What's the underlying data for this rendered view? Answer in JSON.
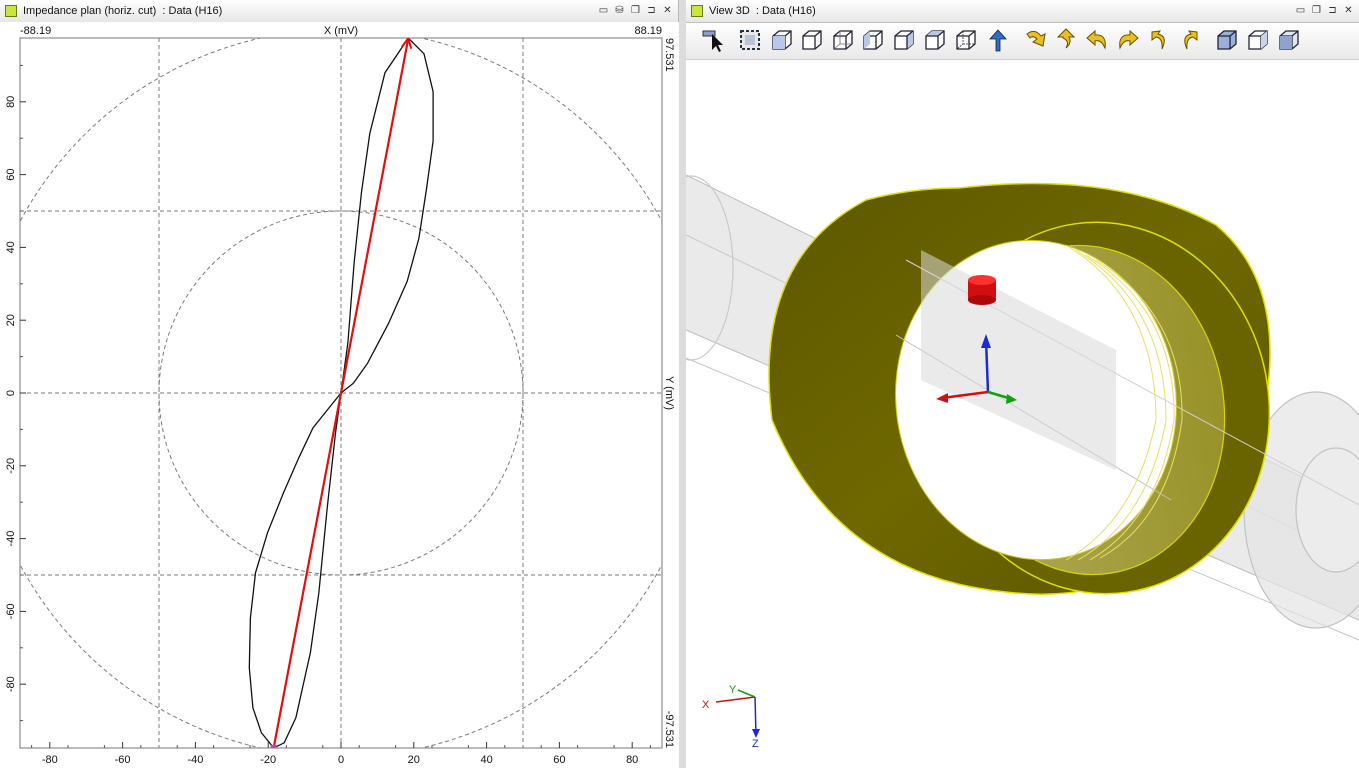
{
  "left_window": {
    "title": "Impedance plan (horiz. cut)  : Data (H16)",
    "window_buttons": [
      "minimize-icon",
      "db-icon",
      "restore-icon",
      "pin-icon",
      "close-icon"
    ]
  },
  "right_window": {
    "title": "View 3D  : Data (H16)",
    "window_buttons": [
      "minimize-icon",
      "restore-icon",
      "pin-icon",
      "close-icon"
    ]
  },
  "chart_data": {
    "type": "line",
    "top_axis": {
      "label": "X (mV)",
      "min_label": "-88.19",
      "max_label": "88.19"
    },
    "right_axis": {
      "label": "Y (mV)",
      "max_label": "97.531",
      "min_label": "-97.531"
    },
    "xlim": [
      -88.19,
      88.19
    ],
    "ylim": [
      -97.531,
      97.531
    ],
    "x_ticks": [
      -80,
      -60,
      -40,
      -20,
      0,
      20,
      40,
      60,
      80
    ],
    "y_ticks": [
      -80,
      -60,
      -40,
      -20,
      0,
      20,
      40,
      60,
      80
    ],
    "grid_x": [
      -50,
      0,
      50
    ],
    "grid_y": [
      -50,
      0,
      50
    ],
    "circle_radii": [
      50,
      100
    ],
    "vector": {
      "from": [
        -18.5,
        -97.5
      ],
      "to": [
        18.5,
        97.5
      ],
      "color": "#e01010"
    },
    "curve": {
      "color": "#111111",
      "points": [
        [
          18.5,
          97.5
        ],
        [
          22.8,
          93.2
        ],
        [
          25.3,
          82.8
        ],
        [
          25.3,
          69.2
        ],
        [
          23.4,
          55.5
        ],
        [
          21.4,
          42.5
        ],
        [
          18.2,
          30.7
        ],
        [
          13.1,
          19.2
        ],
        [
          7.3,
          8.2
        ],
        [
          3.4,
          2.7
        ],
        [
          0,
          0
        ],
        [
          -3.3,
          -4.1
        ],
        [
          -7.7,
          -9.6
        ],
        [
          -11.6,
          -17.8
        ],
        [
          -15.8,
          -27.4
        ],
        [
          -20.2,
          -38.4
        ],
        [
          -23.5,
          -49.4
        ],
        [
          -24.9,
          -61.8
        ],
        [
          -25.2,
          -75.5
        ],
        [
          -24.2,
          -86.5
        ],
        [
          -21.9,
          -93.3
        ],
        [
          -18.5,
          -97.5
        ],
        [
          -15.6,
          -96.1
        ],
        [
          -12.4,
          -89.2
        ],
        [
          -8.4,
          -71.3
        ],
        [
          -6.1,
          -55.0
        ],
        [
          -3.8,
          -31.6
        ],
        [
          -1.5,
          -11.0
        ],
        [
          0,
          0
        ],
        [
          1.9,
          13.8
        ],
        [
          3.6,
          35.7
        ],
        [
          5.6,
          55.0
        ],
        [
          7.9,
          71.3
        ],
        [
          12.1,
          88.0
        ],
        [
          18.5,
          97.5
        ]
      ]
    }
  },
  "axis_triad": {
    "x": "X",
    "y": "Y",
    "z": "Z"
  },
  "toolbar_tools": [
    "select-arrow-icon",
    "zoom-fit-icon",
    "view-iso-cube-icon",
    "view-front-cube-icon",
    "view-back-cube-icon",
    "view-left-cube-icon",
    "view-right-cube-icon",
    "view-top-cube-icon",
    "view-bottom-cube-icon",
    "up-arrow-icon",
    "rotate-down-icon",
    "rotate-up-icon",
    "rotate-left-icon",
    "rotate-right-icon",
    "undo-rotate-icon",
    "redo-rotate-icon",
    "shaded-cube-icon",
    "wireframe-cube-icon",
    "hidden-line-cube-icon"
  ],
  "colors": {
    "coil": "#6b6300",
    "coil_edge": "#e0e000",
    "probe": "#d01010",
    "vector": "#e01010",
    "tube": "#d9d9d9"
  }
}
